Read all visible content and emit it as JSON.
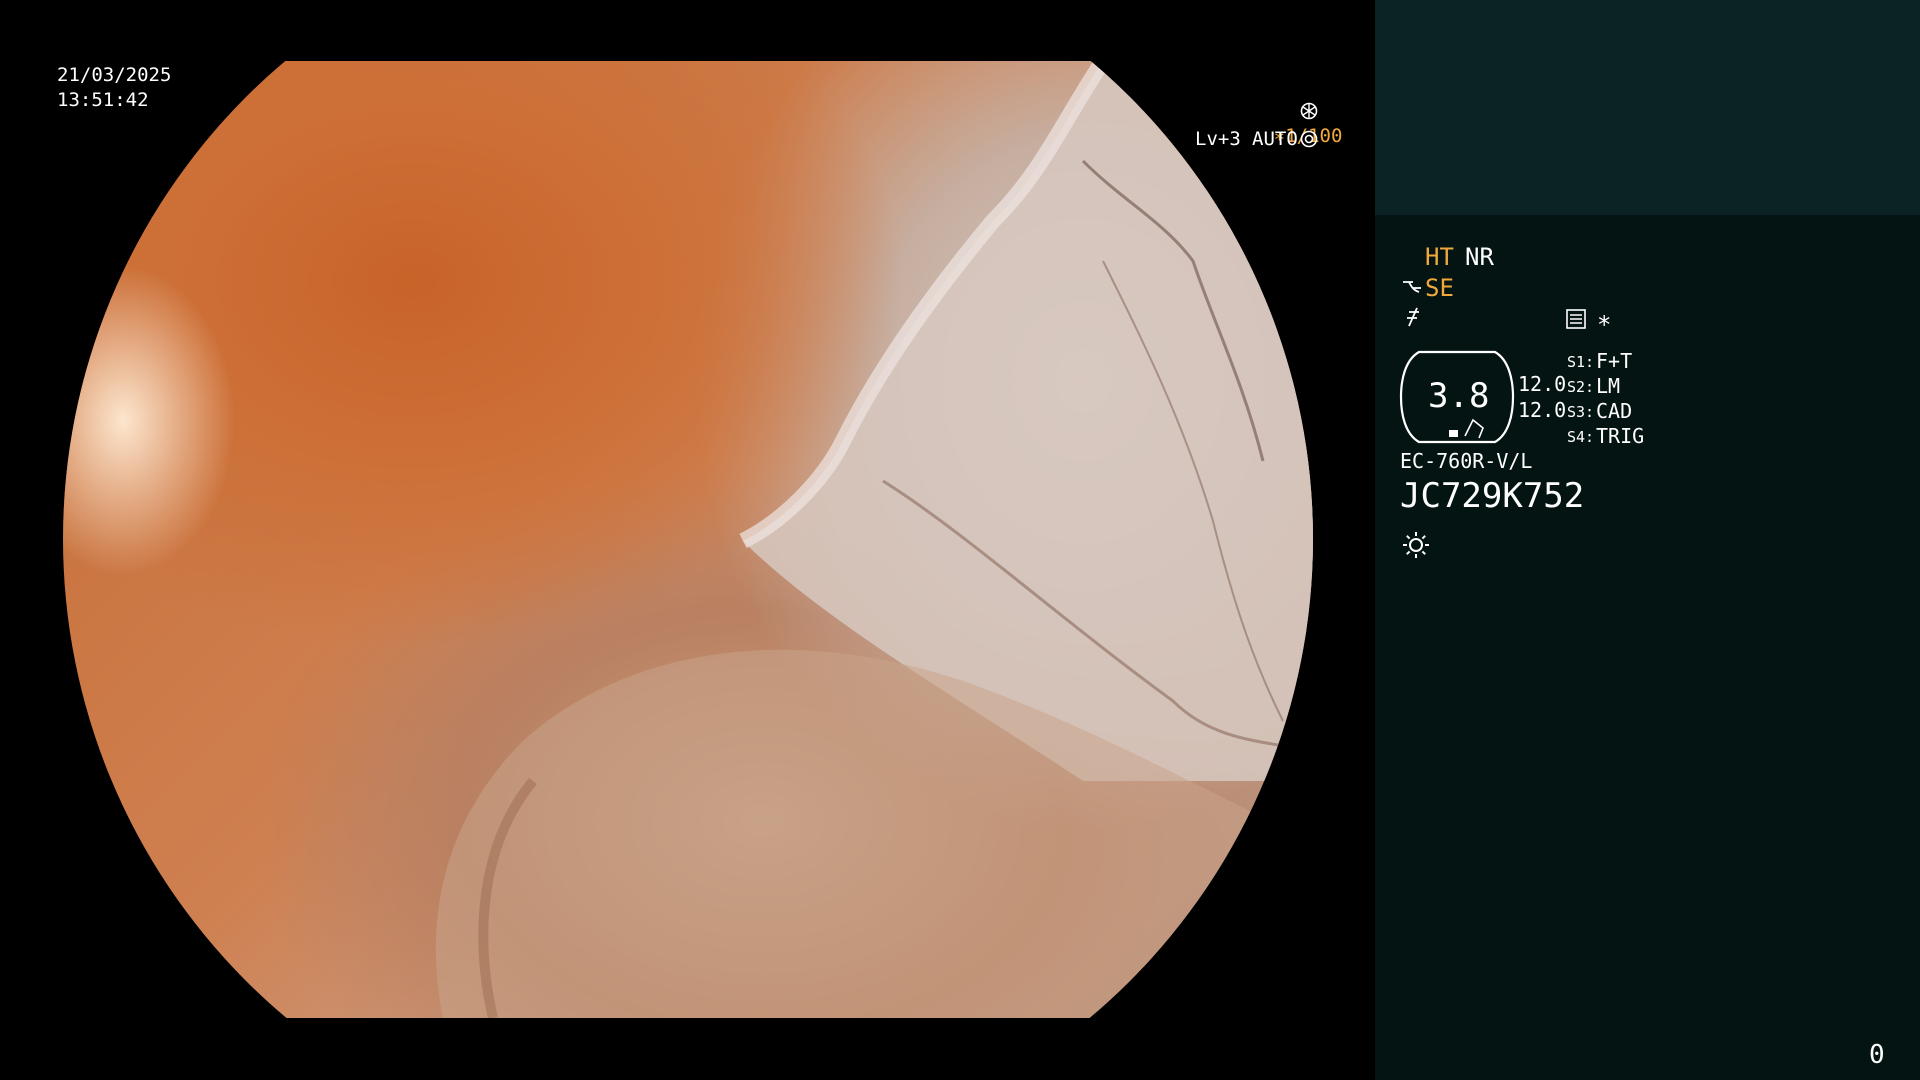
{
  "timestamp": {
    "date": "21/03/2025",
    "time": "13:51:42"
  },
  "shutter": {
    "value": "∗1/100",
    "icon": "aperture-icon"
  },
  "light": {
    "level": "Lv+3",
    "mode": "AUTO",
    "icon": "iris-icon"
  },
  "panel": {
    "ht_label": "HT",
    "nr_label": "NR",
    "se_label": "SE",
    "se_icon": "scope-tip-icon",
    "freeze_icon": "no-freeze-icon",
    "memo_icon": "memo-icon",
    "asterisk": "∗",
    "gauge_value": "3.8",
    "gauge_side_values": [
      "12.0",
      "12.0"
    ],
    "switches": [
      {
        "key": "S1:",
        "label": "F+T"
      },
      {
        "key": "S2:",
        "label": "LM"
      },
      {
        "key": "S3:",
        "label": "CAD"
      },
      {
        "key": "S4:",
        "label": "TRIG"
      }
    ],
    "scope_model": "EC-760R-V/L",
    "serial": "JC729K752",
    "lamp_icon": "sun-icon",
    "counter": "0"
  },
  "colors": {
    "accent_orange": "#f2a93b",
    "panel_bg": "#041412",
    "panel_top_bg": "#0c2326"
  }
}
